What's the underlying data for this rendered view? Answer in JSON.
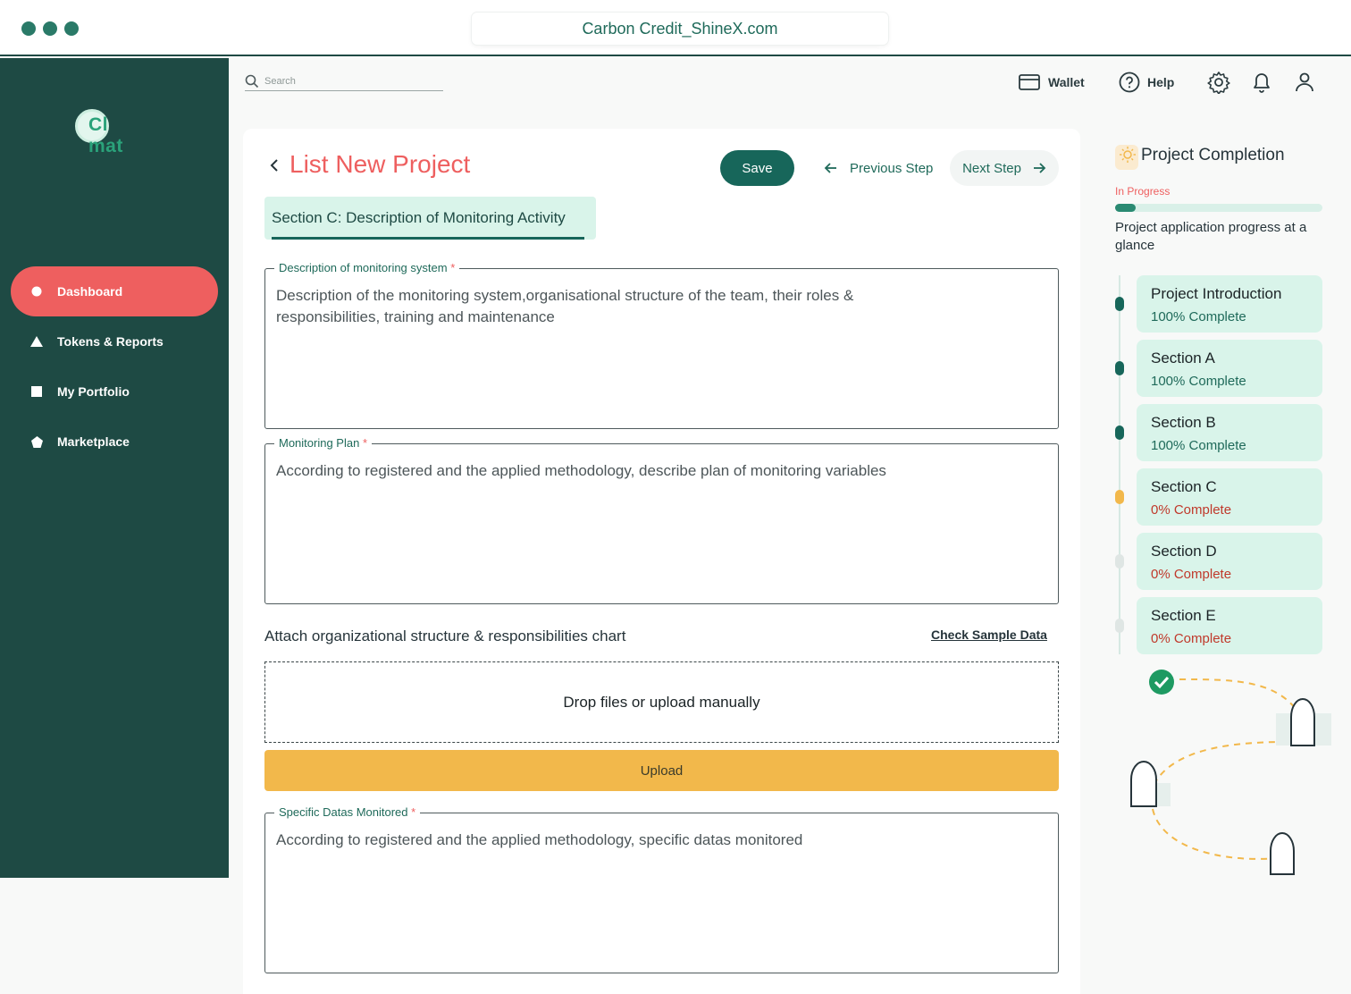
{
  "browser": {
    "url": "Carbon Credit_ShineX.com"
  },
  "brand": {
    "logo_text": "Climat",
    "logo_visible": "Cl mat"
  },
  "sidebar": {
    "items": [
      {
        "label": "Dashboard",
        "icon": "circle-icon",
        "active": true
      },
      {
        "label": "Tokens & Reports",
        "icon": "triangle-icon"
      },
      {
        "label": "My Portfolio",
        "icon": "square-icon"
      },
      {
        "label": "Marketplace",
        "icon": "pentagon-icon"
      }
    ]
  },
  "topbar": {
    "search_placeholder": "Search",
    "wallet_label": "Wallet",
    "help_label": "Help"
  },
  "form": {
    "title": "List New Project",
    "save_label": "Save",
    "prev_label": "Previous Step",
    "next_label": "Next Step",
    "section_label": "Section C: Description of Monitoring Activity",
    "fields": [
      {
        "label": "Description of monitoring system",
        "required": "*",
        "placeholder": "Description of the monitoring system,organisational structure of the team, their roles & responsibilities, training and maintenance"
      },
      {
        "label": "Monitoring Plan",
        "required": "*",
        "placeholder": "According to registered and the applied methodology, describe plan of monitoring variables"
      },
      {
        "label": "Specific Datas Monitored",
        "required": "*",
        "placeholder": "According to registered and the applied methodology, specific datas monitored"
      }
    ],
    "attach_label": "Attach organizational structure & responsibilities chart",
    "sample_link": "Check Sample Data",
    "dropzone_text": "Drop files or upload manually",
    "upload_label": "Upload"
  },
  "completion": {
    "title": "Project Completion",
    "status": "In Progress",
    "progress_fraction": 0.1,
    "description": "Project application progress at a glance",
    "steps": [
      {
        "name": "Project Introduction",
        "pct": "100% Complete",
        "state": "done"
      },
      {
        "name": "Section A",
        "pct": "100% Complete",
        "state": "done"
      },
      {
        "name": "Section B",
        "pct": "100% Complete",
        "state": "done"
      },
      {
        "name": "Section C",
        "pct": "0% Complete",
        "state": "current"
      },
      {
        "name": "Section D",
        "pct": "0% Complete",
        "state": "todo"
      },
      {
        "name": "Section E",
        "pct": "0% Complete",
        "state": "todo"
      }
    ]
  },
  "colors": {
    "brand_dark": "#1e4a44",
    "brand_green": "#17665a",
    "accent_red": "#ee5f5f",
    "upload_yellow": "#f2b84b",
    "mint": "#d9f4ea",
    "done_dot": "#17665a",
    "current_dot": "#f2b84b",
    "todo_dot": "#dfe6e4",
    "done_text": "#1f6a5a",
    "todo_text": "#c0392b"
  }
}
